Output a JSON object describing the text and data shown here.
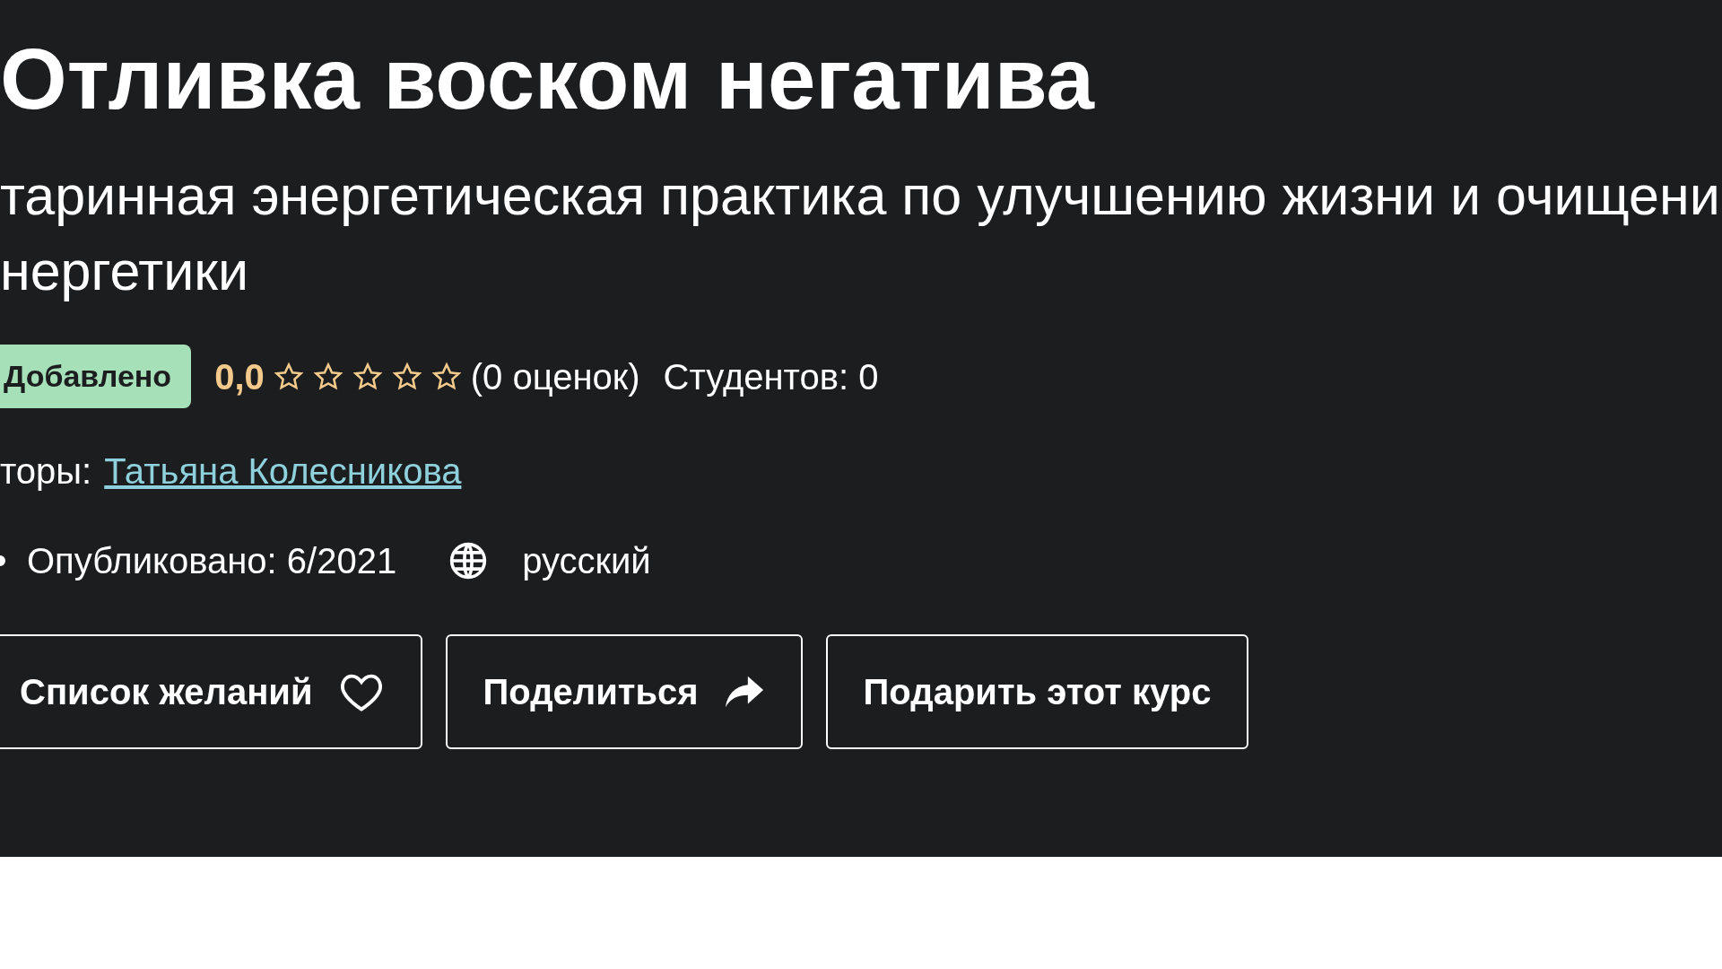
{
  "title": "Отливка воском негатива",
  "subtitle_lines": [
    "таринная энергетическая практика по улучшению жизни и очищени",
    "нергетики"
  ],
  "badge": "Добавлено",
  "rating": {
    "value": "0,0",
    "stars": 0,
    "count": "(0 оценок)"
  },
  "students": "Студентов: 0",
  "authors": {
    "label": "торы:",
    "name": "Татьяна Колесникова"
  },
  "published": "Опубликовано: 6/2021",
  "language": "русский",
  "buttons": [
    {
      "label": "Список желаний",
      "kind": "wishlist"
    },
    {
      "label": "Поделиться",
      "kind": "share"
    },
    {
      "label": "Подарить этот курс",
      "kind": "gift"
    }
  ]
}
